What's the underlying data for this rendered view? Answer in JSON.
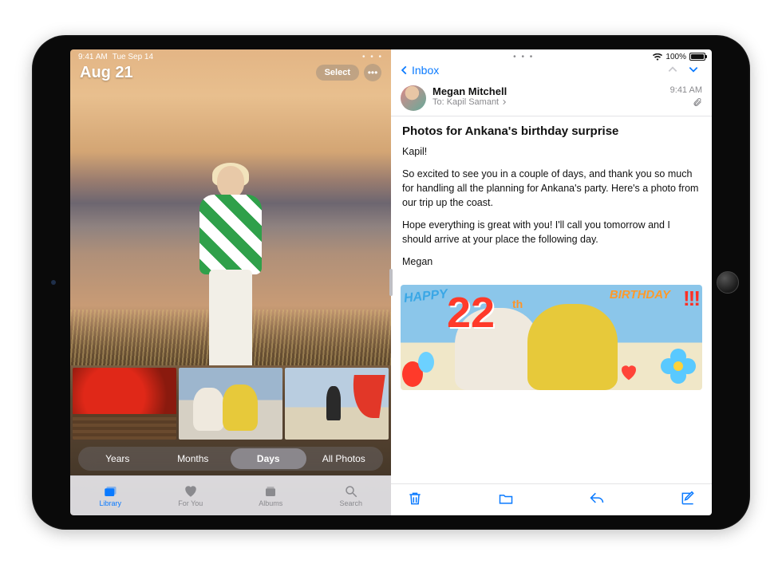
{
  "statusbar_left": {
    "time": "9:41 AM",
    "date": "Tue Sep 14",
    "multitask_dots": "• • •"
  },
  "statusbar_right": {
    "multitask_dots": "• • •",
    "battery_percent": "100%"
  },
  "photos": {
    "date_title": "Aug 21",
    "select_label": "Select",
    "segments": [
      "Years",
      "Months",
      "Days",
      "All Photos"
    ],
    "tabs": [
      {
        "icon": "photo-stack-icon",
        "label": "Library"
      },
      {
        "icon": "heart-person-icon",
        "label": "For You"
      },
      {
        "icon": "album-stack-icon",
        "label": "Albums"
      },
      {
        "icon": "search-icon",
        "label": "Search"
      }
    ]
  },
  "mail": {
    "back_label": "Inbox",
    "from": "Megan Mitchell",
    "to_prefix": "To:",
    "to_name": "Kapil Samant",
    "time": "9:41 AM",
    "subject": "Photos for Ankana's birthday surprise",
    "body_p1": "Kapil!",
    "body_p2": "So excited to see you in a couple of days, and thank you so much for handling all the planning for Ankana's party. Here's a photo from our trip up the coast.",
    "body_p3": "Hope everything is great with you! I'll call you tomorrow and I should arrive at your place the following day.",
    "body_sig": "Megan",
    "attachment_doodles": {
      "happy": "HAPPY",
      "num": "22",
      "th": "th",
      "birthday": "BIRTHDAY",
      "exclaim": "!!!"
    }
  }
}
